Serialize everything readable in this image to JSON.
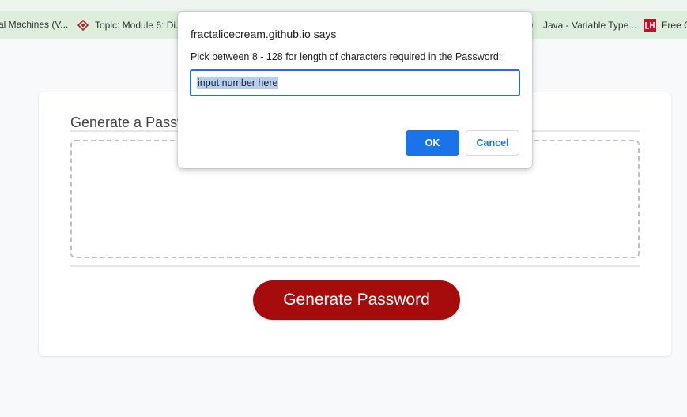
{
  "bookmarks": {
    "items": [
      {
        "label": "al Machines (V...",
        "icon": "none"
      },
      {
        "label": "Topic: Module 6: Di...",
        "icon": "canvas-shield-icon"
      },
      {
        "label": "Java - Variable Type...",
        "icon": "green-dot-icon"
      },
      {
        "label": "Free C",
        "icon": "red-logo-icon"
      }
    ]
  },
  "page": {
    "title": "Generate a Password",
    "generate_button": "Generate Password",
    "colors": {
      "button": "#a70c0c",
      "background": "#f8f9fa"
    }
  },
  "dialog": {
    "title": "fractalicecream.github.io says",
    "message": "Pick between 8 - 128 for length of characters required in the Password:",
    "input_value": "input number here",
    "ok_label": "OK",
    "cancel_label": "Cancel",
    "colors": {
      "accent": "#1a73e8"
    }
  }
}
